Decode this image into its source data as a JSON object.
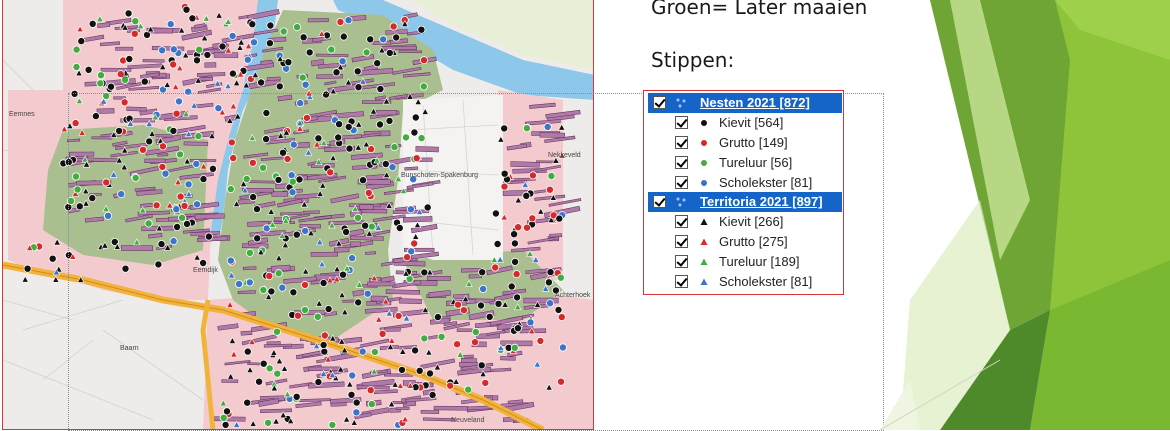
{
  "slide": {
    "heading_green": "Groen= Later maaien",
    "heading_dots": "Stippen:"
  },
  "map": {
    "place_labels": [
      "Eemnes",
      "Nekkeveld",
      "Bunschoten-Spakenburg",
      "Eemdijk",
      "Achterhoek",
      "Baarn",
      "Neuveland",
      "Vo"
    ]
  },
  "legend": {
    "groups": [
      {
        "label": "Nesten 2021 [872]",
        "items": [
          {
            "label": "Kievit [564]",
            "symbol": "circle",
            "color": "#111111"
          },
          {
            "label": "Grutto [149]",
            "symbol": "circle",
            "color": "#d62a2a"
          },
          {
            "label": "Tureluur [56]",
            "symbol": "circle",
            "color": "#3fae3f"
          },
          {
            "label": "Scholekster [81]",
            "symbol": "circle",
            "color": "#3b74c9"
          }
        ]
      },
      {
        "label": "Territoria 2021 [897]",
        "items": [
          {
            "label": "Kievit [266]",
            "symbol": "triangle",
            "color": "#111111"
          },
          {
            "label": "Grutto [275]",
            "symbol": "triangle",
            "color": "#d62a2a"
          },
          {
            "label": "Tureluur [189]",
            "symbol": "triangle",
            "color": "#3fae3f"
          },
          {
            "label": "Scholekster [81]",
            "symbol": "triangle",
            "color": "#3b74c9"
          }
        ]
      }
    ]
  },
  "colors": {
    "legend_header": "#1565c8",
    "frame_border": "#d8343a",
    "meadow": "#a9bf8f",
    "agri_pink": "#f3cbcf",
    "water": "#8dc7ea",
    "highway": "#f2b33d",
    "plot_purple": "#b07aa8"
  }
}
